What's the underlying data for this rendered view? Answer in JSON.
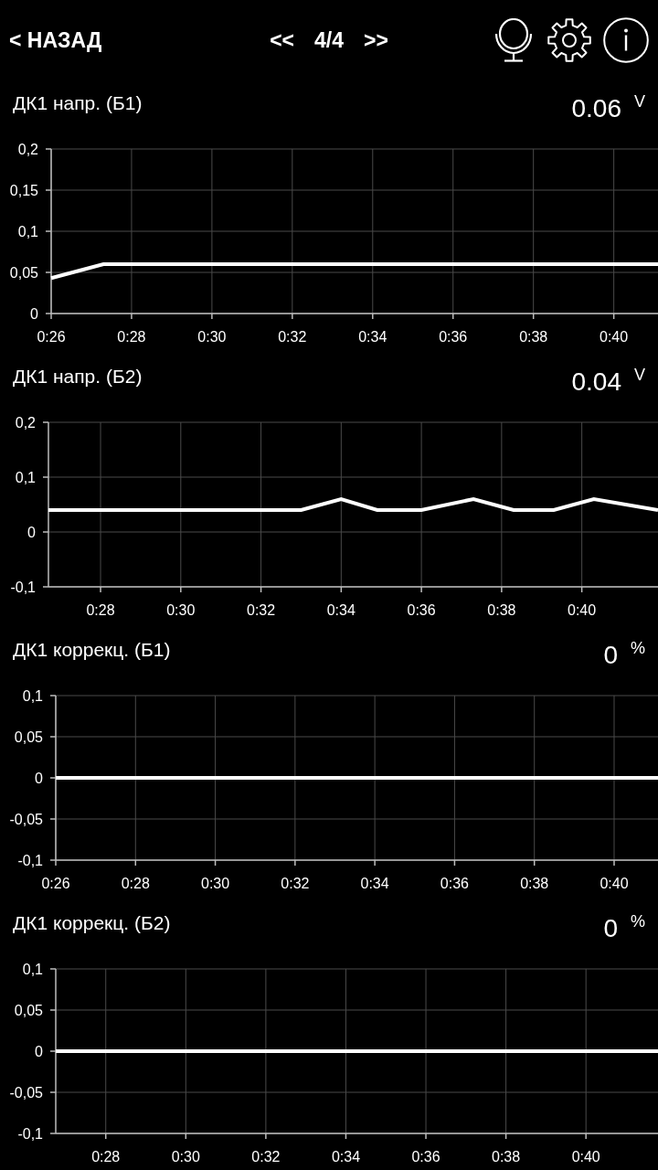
{
  "header": {
    "back_button": "< НАЗАД",
    "prev_button": "<<",
    "page_indicator": "4/4",
    "next_button": ">>"
  },
  "sections": [
    {
      "title": "ДК1 напр. (Б1)",
      "value": "0.06",
      "unit": "V",
      "chart_data": {
        "type": "line",
        "grid": true,
        "x": [
          26,
          27.3,
          41.1
        ],
        "values": [
          0.043,
          0.06,
          0.06
        ],
        "xlim": [
          26,
          41.1
        ],
        "ylim": [
          0,
          0.2
        ],
        "xticks": [
          {
            "value": 26,
            "label": "0:26"
          },
          {
            "value": 28,
            "label": "0:28"
          },
          {
            "value": 30,
            "label": "0:30"
          },
          {
            "value": 32,
            "label": "0:32"
          },
          {
            "value": 34,
            "label": "0:34"
          },
          {
            "value": 36,
            "label": "0:36"
          },
          {
            "value": 38,
            "label": "0:38"
          },
          {
            "value": 40,
            "label": "0:40"
          }
        ],
        "yticks": [
          {
            "value": 0,
            "label": "0"
          },
          {
            "value": 0.05,
            "label": "0,05"
          },
          {
            "value": 0.1,
            "label": "0,1"
          },
          {
            "value": 0.15,
            "label": "0,15"
          },
          {
            "value": 0.2,
            "label": "0,2"
          }
        ]
      }
    },
    {
      "title": "ДК1 напр. (Б2)",
      "value": "0.04",
      "unit": "V",
      "chart_data": {
        "type": "line",
        "grid": true,
        "x": [
          26.7,
          33.0,
          34.0,
          34.9,
          36.0,
          37.3,
          38.3,
          39.3,
          40.3,
          41.9
        ],
        "values": [
          0.04,
          0.04,
          0.06,
          0.04,
          0.04,
          0.06,
          0.04,
          0.04,
          0.06,
          0.04
        ],
        "xlim": [
          26.7,
          41.9
        ],
        "ylim": [
          -0.1,
          0.2
        ],
        "xticks": [
          {
            "value": 28,
            "label": "0:28"
          },
          {
            "value": 30,
            "label": "0:30"
          },
          {
            "value": 32,
            "label": "0:32"
          },
          {
            "value": 34,
            "label": "0:34"
          },
          {
            "value": 36,
            "label": "0:36"
          },
          {
            "value": 38,
            "label": "0:38"
          },
          {
            "value": 40,
            "label": "0:40"
          }
        ],
        "yticks": [
          {
            "value": -0.1,
            "label": "-0,1"
          },
          {
            "value": 0,
            "label": "0"
          },
          {
            "value": 0.1,
            "label": "0,1"
          },
          {
            "value": 0.2,
            "label": "0,2"
          }
        ]
      }
    },
    {
      "title": "ДК1 коррекц. (Б1)",
      "value": "0",
      "unit": "%",
      "chart_data": {
        "type": "line",
        "grid": true,
        "x": [
          26,
          41.1
        ],
        "values": [
          0,
          0
        ],
        "xlim": [
          26,
          41.1
        ],
        "ylim": [
          -0.1,
          0.1
        ],
        "xticks": [
          {
            "value": 26,
            "label": "0:26"
          },
          {
            "value": 28,
            "label": "0:28"
          },
          {
            "value": 30,
            "label": "0:30"
          },
          {
            "value": 32,
            "label": "0:32"
          },
          {
            "value": 34,
            "label": "0:34"
          },
          {
            "value": 36,
            "label": "0:36"
          },
          {
            "value": 38,
            "label": "0:38"
          },
          {
            "value": 40,
            "label": "0:40"
          }
        ],
        "yticks": [
          {
            "value": -0.1,
            "label": "-0,1"
          },
          {
            "value": -0.05,
            "label": "-0,05"
          },
          {
            "value": 0,
            "label": "0"
          },
          {
            "value": 0.05,
            "label": "0,05"
          },
          {
            "value": 0.1,
            "label": "0,1"
          }
        ]
      }
    },
    {
      "title": "ДК1 коррекц. (Б2)",
      "value": "0",
      "unit": "%",
      "chart_data": {
        "type": "line",
        "grid": true,
        "x": [
          26.75,
          41.8
        ],
        "values": [
          0,
          0
        ],
        "xlim": [
          26.75,
          41.8
        ],
        "ylim": [
          -0.1,
          0.1
        ],
        "xticks": [
          {
            "value": 28,
            "label": "0:28"
          },
          {
            "value": 30,
            "label": "0:30"
          },
          {
            "value": 32,
            "label": "0:32"
          },
          {
            "value": 34,
            "label": "0:34"
          },
          {
            "value": 36,
            "label": "0:36"
          },
          {
            "value": 38,
            "label": "0:38"
          },
          {
            "value": 40,
            "label": "0:40"
          }
        ],
        "yticks": [
          {
            "value": -0.1,
            "label": "-0,1"
          },
          {
            "value": -0.05,
            "label": "-0,05"
          },
          {
            "value": 0,
            "label": "0"
          },
          {
            "value": 0.05,
            "label": "0,05"
          },
          {
            "value": 0.1,
            "label": "0,1"
          }
        ]
      }
    }
  ]
}
